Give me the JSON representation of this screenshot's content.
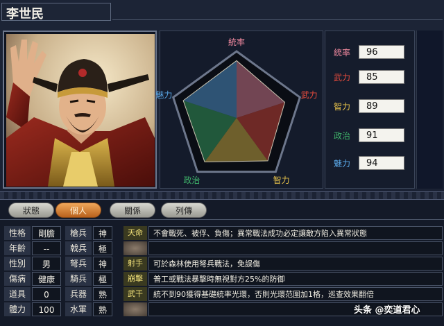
{
  "officer": {
    "name": "李世民"
  },
  "radar": {
    "labels": [
      {
        "key": "command",
        "text": "統率",
        "color": "#f28aa0"
      },
      {
        "key": "war",
        "text": "武力",
        "color": "#e94b3c"
      },
      {
        "key": "intel",
        "text": "智力",
        "color": "#e8c34a"
      },
      {
        "key": "politics",
        "text": "政治",
        "color": "#3fb36a"
      },
      {
        "key": "charm",
        "text": "魅力",
        "color": "#5aa8e8"
      }
    ],
    "values": [
      96,
      85,
      89,
      91,
      94
    ],
    "max": 100
  },
  "stats": [
    {
      "label": "統率",
      "value": "96",
      "color": "#f28aa0"
    },
    {
      "label": "武力",
      "value": "85",
      "color": "#e94b3c"
    },
    {
      "label": "智力",
      "value": "89",
      "color": "#e8c34a"
    },
    {
      "label": "政治",
      "value": "91",
      "color": "#3fb36a"
    },
    {
      "label": "魅力",
      "value": "94",
      "color": "#5aa8e8"
    }
  ],
  "tabs": [
    {
      "label": "狀態",
      "active": false
    },
    {
      "label": "個人",
      "active": true
    },
    {
      "label": "關係",
      "active": false
    },
    {
      "label": "列傳",
      "active": false
    }
  ],
  "profile": [
    {
      "label": "性格",
      "value": "剛膽"
    },
    {
      "label": "年齡",
      "value": "--"
    },
    {
      "label": "性別",
      "value": "男"
    },
    {
      "label": "傷病",
      "value": "健康"
    },
    {
      "label": "道具",
      "value": "0"
    },
    {
      "label": "體力",
      "value": "100"
    }
  ],
  "aptitudes": [
    {
      "label": "槍兵",
      "value": "神"
    },
    {
      "label": "戟兵",
      "value": "極"
    },
    {
      "label": "弩兵",
      "value": "神"
    },
    {
      "label": "騎兵",
      "value": "極"
    },
    {
      "label": "兵器",
      "value": "熟"
    },
    {
      "label": "水軍",
      "value": "熟"
    }
  ],
  "skills": [
    {
      "name": "天命",
      "desc": "不會戰死、被俘、負傷；異常戰法成功必定讓敵方陷入異常狀態"
    },
    {
      "name": "",
      "desc": ""
    },
    {
      "name": "射手",
      "desc": "可於森林使用弩兵戰法，免誤傷"
    },
    {
      "name": "崩擊",
      "desc": "普工或戰法暴擊時無視對方25%的防御"
    },
    {
      "name": "武干",
      "desc": "統不到90獲得基礎統率光環，否則光環范圍加1格，巡查效果翻倍"
    },
    {
      "name": "",
      "desc": ""
    }
  ],
  "watermark": "头条 @奕道君心"
}
